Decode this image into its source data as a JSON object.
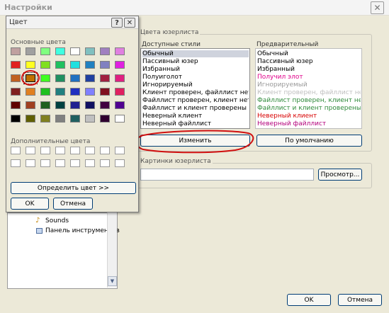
{
  "window": {
    "title": "Настройки"
  },
  "color_dialog": {
    "title": "Цвет",
    "help_glyph": "?",
    "basic_colors_label": "Основные цвета",
    "custom_colors_label": "Дополнительные цвета",
    "define_button": "Определить цвет >>",
    "ok_button": "OK",
    "cancel_button": "Отмена",
    "basic_colors": [
      [
        "#c0a0a0",
        "#a0a0a0",
        "#80ff80",
        "#40ffe0",
        "#ffffff",
        "#80c0c0",
        "#a080c0",
        "#e080e0"
      ],
      [
        "#e02020",
        "#ffff20",
        "#80e020",
        "#20c060",
        "#20e0e0",
        "#2080c0",
        "#8080c0",
        "#e020e0"
      ],
      [
        "#c06020",
        "#c07000",
        "#40ff20",
        "#209060",
        "#2070c0",
        "#2040a0",
        "#a02040",
        "#e02080"
      ],
      [
        "#802020",
        "#e08020",
        "#20c020",
        "#208080",
        "#2030c0",
        "#8080ff",
        "#801020",
        "#e02060"
      ],
      [
        "#600000",
        "#a04020",
        "#206020",
        "#004040",
        "#202090",
        "#101060",
        "#400040",
        "#500090"
      ],
      [
        "#000000",
        "#606000",
        "#808020",
        "#808080",
        "#206060",
        "#c0c0c0",
        "#300030",
        "#ffffff"
      ]
    ],
    "selected_color": "#c07000"
  },
  "styles_group": {
    "title": "Цвета юзерлиста",
    "available_label": "Доступные стили",
    "preview_label": "Предварительный",
    "available_styles": [
      "Обычный",
      "Пассивный юзер",
      "Избранный",
      "Полуиголот",
      "Игнорируемый",
      "Клиент проверен, файллист нет",
      "Файллист проверен, клиент нет",
      "Файллист и клиент проверены",
      "Неверный клиент",
      "Неверный файллист"
    ],
    "preview_items": [
      {
        "text": "Обычный",
        "color": "#000000"
      },
      {
        "text": "Пассивный юзер",
        "color": "#000000"
      },
      {
        "text": "Избранный",
        "color": "#000000"
      },
      {
        "text": "Получил элот",
        "color": "#e0008a"
      },
      {
        "text": "Игнорируемый",
        "color": "#999999"
      },
      {
        "text": "Клиент проверен, файллист нет",
        "color": "#bfbfbf"
      },
      {
        "text": "Файллист проверен, клиент нет",
        "color": "#2f8a3b"
      },
      {
        "text": "Файллист и клиент проверены",
        "color": "#2f8a3b"
      },
      {
        "text": "Неверный клиент",
        "color": "#d80000"
      },
      {
        "text": "Неверный файллист",
        "color": "#b4007c"
      }
    ],
    "change_button": "Изменить",
    "default_button": "По умолчанию"
  },
  "images_group": {
    "title": "Картинки юзерлиста",
    "path_value": "",
    "browse_button": "Просмотр..."
  },
  "tree": {
    "items": [
      "Sounds",
      "Панель инструментов"
    ]
  },
  "footer": {
    "ok_button": "OK",
    "cancel_button": "Отмена"
  }
}
